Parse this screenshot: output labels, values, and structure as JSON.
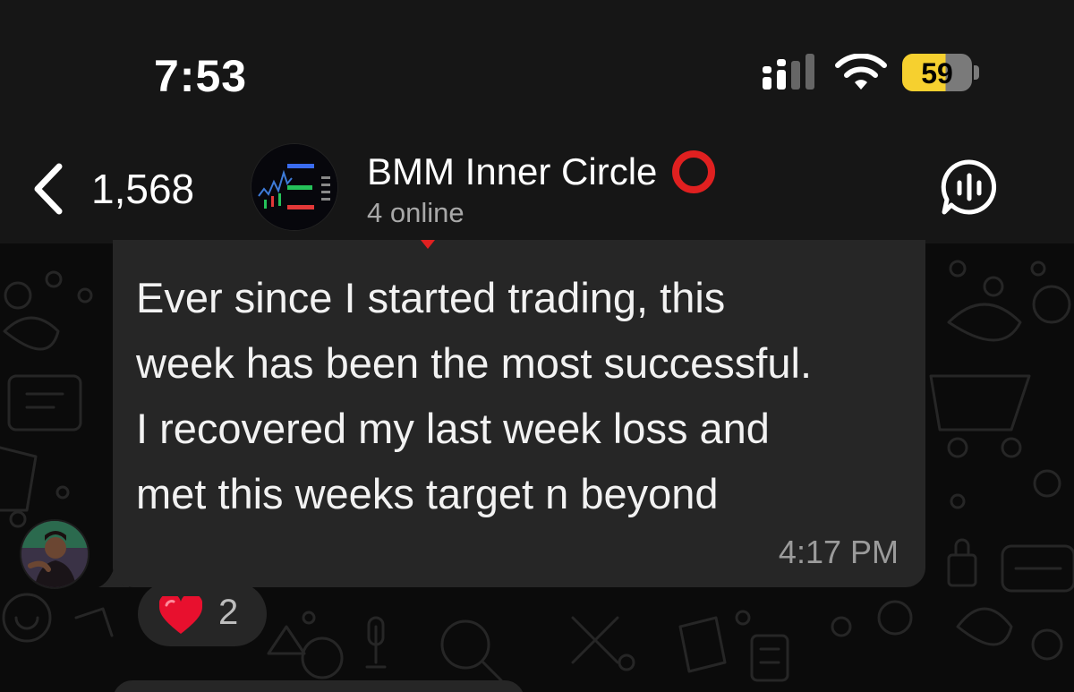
{
  "status_bar": {
    "time": "7:53",
    "battery_percent": "59",
    "signal_icon": "cellular-signal-icon",
    "wifi_icon": "wifi-icon"
  },
  "header": {
    "back_count": "1,568",
    "group_name": "BMM Inner Circle",
    "status": "4 online",
    "title_emoji_icon": "red-hollow-circle-icon",
    "voice_chat_icon": "voice-chat-icon"
  },
  "message": {
    "lines": [
      "Ever since I started trading, this",
      "week has been the most successful.",
      "I recovered my last week loss and",
      "met this weeks target n beyond"
    ],
    "time": "4:17 PM"
  },
  "reaction": {
    "emoji_icon": "red-heart-icon",
    "count": "2"
  },
  "colors": {
    "background": "#0b0b0b",
    "header": "#161616",
    "bubble": "#262626",
    "battery": "#f6d02f",
    "accent_red": "#e02020"
  }
}
